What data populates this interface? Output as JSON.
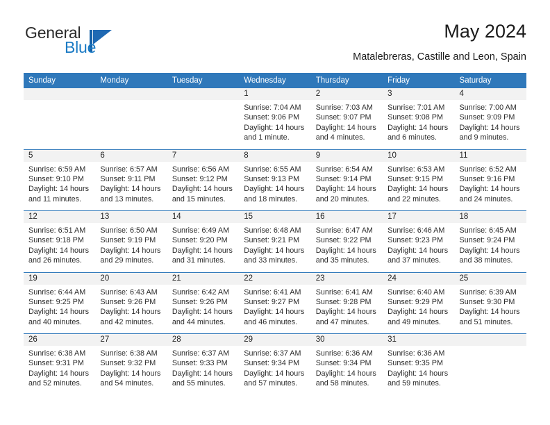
{
  "brand": {
    "name_part1": "General",
    "name_part2": "Blue"
  },
  "header": {
    "month_title": "May 2024",
    "location": "Matalebreras, Castille and Leon, Spain"
  },
  "theme": {
    "header_blue": "#2f78ba",
    "brand_blue": "#1a7ac4",
    "daynum_band": "#f2f2f2"
  },
  "calendar": {
    "weekday_headers": [
      "Sunday",
      "Monday",
      "Tuesday",
      "Wednesday",
      "Thursday",
      "Friday",
      "Saturday"
    ],
    "weeks": [
      [
        {
          "day": "",
          "lines": []
        },
        {
          "day": "",
          "lines": []
        },
        {
          "day": "",
          "lines": []
        },
        {
          "day": "1",
          "lines": [
            "Sunrise: 7:04 AM",
            "Sunset: 9:06 PM",
            "Daylight: 14 hours",
            "and 1 minute."
          ]
        },
        {
          "day": "2",
          "lines": [
            "Sunrise: 7:03 AM",
            "Sunset: 9:07 PM",
            "Daylight: 14 hours",
            "and 4 minutes."
          ]
        },
        {
          "day": "3",
          "lines": [
            "Sunrise: 7:01 AM",
            "Sunset: 9:08 PM",
            "Daylight: 14 hours",
            "and 6 minutes."
          ]
        },
        {
          "day": "4",
          "lines": [
            "Sunrise: 7:00 AM",
            "Sunset: 9:09 PM",
            "Daylight: 14 hours",
            "and 9 minutes."
          ]
        }
      ],
      [
        {
          "day": "5",
          "lines": [
            "Sunrise: 6:59 AM",
            "Sunset: 9:10 PM",
            "Daylight: 14 hours",
            "and 11 minutes."
          ]
        },
        {
          "day": "6",
          "lines": [
            "Sunrise: 6:57 AM",
            "Sunset: 9:11 PM",
            "Daylight: 14 hours",
            "and 13 minutes."
          ]
        },
        {
          "day": "7",
          "lines": [
            "Sunrise: 6:56 AM",
            "Sunset: 9:12 PM",
            "Daylight: 14 hours",
            "and 15 minutes."
          ]
        },
        {
          "day": "8",
          "lines": [
            "Sunrise: 6:55 AM",
            "Sunset: 9:13 PM",
            "Daylight: 14 hours",
            "and 18 minutes."
          ]
        },
        {
          "day": "9",
          "lines": [
            "Sunrise: 6:54 AM",
            "Sunset: 9:14 PM",
            "Daylight: 14 hours",
            "and 20 minutes."
          ]
        },
        {
          "day": "10",
          "lines": [
            "Sunrise: 6:53 AM",
            "Sunset: 9:15 PM",
            "Daylight: 14 hours",
            "and 22 minutes."
          ]
        },
        {
          "day": "11",
          "lines": [
            "Sunrise: 6:52 AM",
            "Sunset: 9:16 PM",
            "Daylight: 14 hours",
            "and 24 minutes."
          ]
        }
      ],
      [
        {
          "day": "12",
          "lines": [
            "Sunrise: 6:51 AM",
            "Sunset: 9:18 PM",
            "Daylight: 14 hours",
            "and 26 minutes."
          ]
        },
        {
          "day": "13",
          "lines": [
            "Sunrise: 6:50 AM",
            "Sunset: 9:19 PM",
            "Daylight: 14 hours",
            "and 29 minutes."
          ]
        },
        {
          "day": "14",
          "lines": [
            "Sunrise: 6:49 AM",
            "Sunset: 9:20 PM",
            "Daylight: 14 hours",
            "and 31 minutes."
          ]
        },
        {
          "day": "15",
          "lines": [
            "Sunrise: 6:48 AM",
            "Sunset: 9:21 PM",
            "Daylight: 14 hours",
            "and 33 minutes."
          ]
        },
        {
          "day": "16",
          "lines": [
            "Sunrise: 6:47 AM",
            "Sunset: 9:22 PM",
            "Daylight: 14 hours",
            "and 35 minutes."
          ]
        },
        {
          "day": "17",
          "lines": [
            "Sunrise: 6:46 AM",
            "Sunset: 9:23 PM",
            "Daylight: 14 hours",
            "and 37 minutes."
          ]
        },
        {
          "day": "18",
          "lines": [
            "Sunrise: 6:45 AM",
            "Sunset: 9:24 PM",
            "Daylight: 14 hours",
            "and 38 minutes."
          ]
        }
      ],
      [
        {
          "day": "19",
          "lines": [
            "Sunrise: 6:44 AM",
            "Sunset: 9:25 PM",
            "Daylight: 14 hours",
            "and 40 minutes."
          ]
        },
        {
          "day": "20",
          "lines": [
            "Sunrise: 6:43 AM",
            "Sunset: 9:26 PM",
            "Daylight: 14 hours",
            "and 42 minutes."
          ]
        },
        {
          "day": "21",
          "lines": [
            "Sunrise: 6:42 AM",
            "Sunset: 9:26 PM",
            "Daylight: 14 hours",
            "and 44 minutes."
          ]
        },
        {
          "day": "22",
          "lines": [
            "Sunrise: 6:41 AM",
            "Sunset: 9:27 PM",
            "Daylight: 14 hours",
            "and 46 minutes."
          ]
        },
        {
          "day": "23",
          "lines": [
            "Sunrise: 6:41 AM",
            "Sunset: 9:28 PM",
            "Daylight: 14 hours",
            "and 47 minutes."
          ]
        },
        {
          "day": "24",
          "lines": [
            "Sunrise: 6:40 AM",
            "Sunset: 9:29 PM",
            "Daylight: 14 hours",
            "and 49 minutes."
          ]
        },
        {
          "day": "25",
          "lines": [
            "Sunrise: 6:39 AM",
            "Sunset: 9:30 PM",
            "Daylight: 14 hours",
            "and 51 minutes."
          ]
        }
      ],
      [
        {
          "day": "26",
          "lines": [
            "Sunrise: 6:38 AM",
            "Sunset: 9:31 PM",
            "Daylight: 14 hours",
            "and 52 minutes."
          ]
        },
        {
          "day": "27",
          "lines": [
            "Sunrise: 6:38 AM",
            "Sunset: 9:32 PM",
            "Daylight: 14 hours",
            "and 54 minutes."
          ]
        },
        {
          "day": "28",
          "lines": [
            "Sunrise: 6:37 AM",
            "Sunset: 9:33 PM",
            "Daylight: 14 hours",
            "and 55 minutes."
          ]
        },
        {
          "day": "29",
          "lines": [
            "Sunrise: 6:37 AM",
            "Sunset: 9:34 PM",
            "Daylight: 14 hours",
            "and 57 minutes."
          ]
        },
        {
          "day": "30",
          "lines": [
            "Sunrise: 6:36 AM",
            "Sunset: 9:34 PM",
            "Daylight: 14 hours",
            "and 58 minutes."
          ]
        },
        {
          "day": "31",
          "lines": [
            "Sunrise: 6:36 AM",
            "Sunset: 9:35 PM",
            "Daylight: 14 hours",
            "and 59 minutes."
          ]
        },
        {
          "day": "",
          "lines": []
        }
      ]
    ]
  }
}
